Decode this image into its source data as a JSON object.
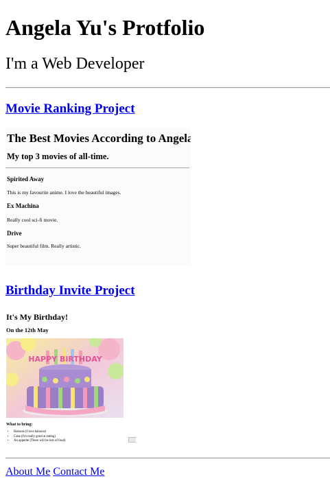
{
  "header": {
    "title": "Angela Yu's Protfolio",
    "subtitle": "I'm a Web Developer"
  },
  "projects": [
    {
      "link_label": "Movie Ranking Project",
      "screenshot": {
        "title": "The Best Movies According to Angela",
        "subtitle": "My top 3 movies of all-time.",
        "movies": [
          {
            "name": "Spirited Away",
            "desc": "This is my favourite anime. I love the beautiful images."
          },
          {
            "name": "Ex Machina",
            "desc": "Really cool sci-fi movie."
          },
          {
            "name": "Drive",
            "desc": "Super beautiful film. Really artistic."
          }
        ]
      }
    },
    {
      "link_label": "Birthday Invite Project",
      "screenshot": {
        "title": "It's My Birthday!",
        "date": "On the 12th May",
        "cake_banner": "HAPPY BIRTHDAY",
        "bring_heading": "What to bring:",
        "bring_items": [
          "Baloons (I love baloons)",
          "Cake (I'm really good at eating)",
          "An appetite (There will be lots of food)"
        ]
      }
    }
  ],
  "footer": {
    "about_label": "About Me",
    "contact_label": "Contact Me"
  }
}
